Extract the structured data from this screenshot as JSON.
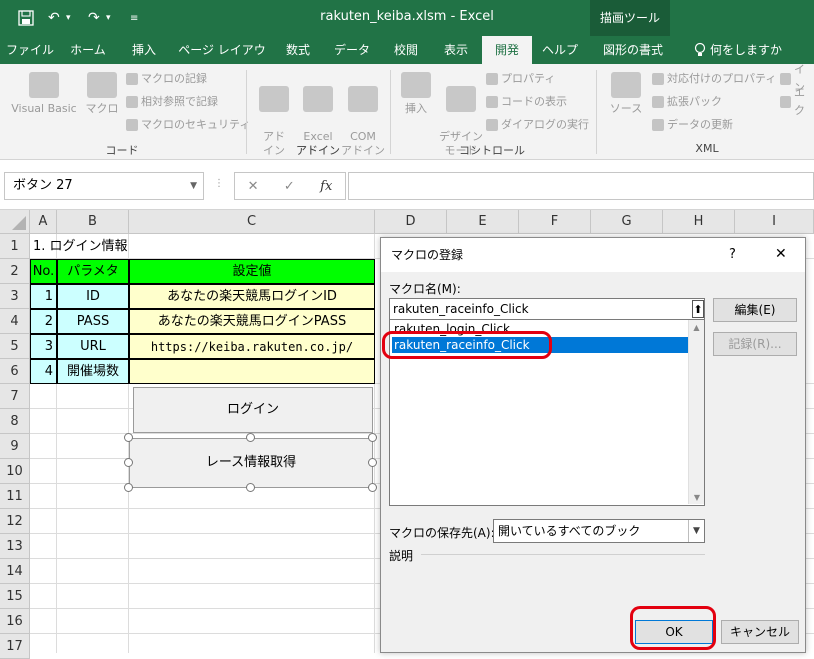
{
  "app": {
    "doc_title": "rakuten_keiba.xlsm  -  Excel",
    "context_tab": "描画ツール"
  },
  "tabs": [
    "ファイル",
    "ホーム",
    "挿入",
    "ページ レイアウト",
    "数式",
    "データ",
    "校閲",
    "表示",
    "開発",
    "ヘルプ",
    "図形の書式",
    "何をしますか"
  ],
  "active_tab": "開発",
  "ribbon": {
    "code": {
      "label": "コード",
      "visual_basic": "Visual Basic",
      "macro": "マクロ",
      "record_macro": "マクロの記録",
      "relative_ref": "相対参照で記録",
      "macro_security": "マクロのセキュリティ"
    },
    "addins": {
      "label": "アドイン",
      "addin": "アド\nイン",
      "excel_addin": "Excel\nアドイン",
      "com_addin": "COM\nアドイン"
    },
    "controls": {
      "label": "コントロール",
      "insert": "挿入",
      "design_mode": "デザイン\nモード",
      "properties": "プロパティ",
      "view_code": "コードの表示",
      "run_dialog": "ダイアログの実行"
    },
    "xml": {
      "label": "XML",
      "source": "ソース",
      "map_properties": "対応付けのプロパティ",
      "expansion_packs": "拡張パック",
      "refresh_data": "データの更新",
      "import": "イン",
      "export": "エク"
    }
  },
  "formula_bar": {
    "name_box": "ボタン 27",
    "cancel": "✕",
    "enter": "✓",
    "fx": "fx",
    "value": ""
  },
  "sheet": {
    "columns": [
      "A",
      "B",
      "C",
      "D",
      "E",
      "F",
      "G",
      "H",
      "I"
    ],
    "rows": [
      "1",
      "2",
      "3",
      "4",
      "5",
      "6",
      "7",
      "8",
      "9",
      "10",
      "11",
      "12",
      "13",
      "14",
      "15",
      "16",
      "17"
    ],
    "a1": "1. ログイン情報",
    "header": {
      "no": "No.",
      "param": "パラメタ",
      "value": "設定値"
    },
    "table_rows": [
      {
        "no": "1",
        "param": "ID",
        "value": "あなたの楽天競馬ログインID"
      },
      {
        "no": "2",
        "param": "PASS",
        "value": "あなたの楽天競馬ログインPASS"
      },
      {
        "no": "3",
        "param": "URL",
        "value": "https://keiba.rakuten.co.jp/"
      },
      {
        "no": "4",
        "param": "開催場数",
        "value": ""
      }
    ],
    "login_button": "ログイン",
    "race_button": "レース情報取得"
  },
  "colors": {
    "excel_green": "#217346",
    "header_green": "#00ff00",
    "param_cyan": "#ccffff",
    "value_yellow": "#ffffcc",
    "selection_blue": "#0078d7",
    "highlight_red": "#e3000f"
  },
  "dialog": {
    "title": "マクロの登録",
    "help": "?",
    "close": "✕",
    "macro_name_label": "マクロ名(M):",
    "macro_name_value": "rakuten_raceinfo_Click",
    "macro_list": [
      "rakuten_login_Click",
      "rakuten_raceinfo_Click"
    ],
    "selected_index": 1,
    "edit_button": "編集(E)",
    "record_button": "記録(R)...",
    "save_location_label": "マクロの保存先(A):",
    "save_location_value": "開いているすべてのブック",
    "description_label": "説明",
    "ok_button": "OK",
    "cancel_button": "キャンセル"
  }
}
